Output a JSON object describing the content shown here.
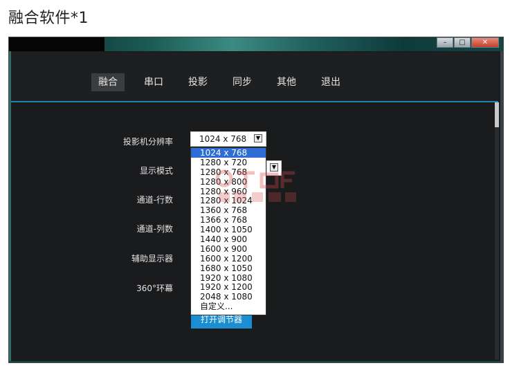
{
  "page_heading": "融合软件*1",
  "window": {
    "controls": {
      "minimize": "–",
      "maximize": "□",
      "close": "✕"
    }
  },
  "menu": {
    "items": [
      {
        "label": "融合",
        "active": true
      },
      {
        "label": "串口",
        "active": false
      },
      {
        "label": "投影",
        "active": false
      },
      {
        "label": "同步",
        "active": false
      },
      {
        "label": "其他",
        "active": false
      },
      {
        "label": "退出",
        "active": false
      }
    ]
  },
  "form": {
    "projector_resolution_label": "投影机分辨率",
    "projector_resolution_value": "1024 x 768",
    "display_mode_label": "显示模式",
    "channel_rows_label": "通道-行数",
    "channel_cols_label": "通道-列数",
    "aux_display_label": "辅助显示器",
    "curtain_360_label": "360°环幕"
  },
  "dropdown": {
    "options": [
      "1024 x 768",
      "1280 x 720",
      "1280 x 768",
      "1280 x 800",
      "1280 x 960",
      "1280 x 1024",
      "1360 x 768",
      "1366 x 768",
      "1400 x 1050",
      "1440 x 900",
      "1600 x 900",
      "1600 x 1200",
      "1680 x 1050",
      "1920 x 1080",
      "1920 x 1200",
      "2048 x 1080",
      "自定义..."
    ],
    "selected_index": 0
  },
  "open_adjuster_button": "打开调节器",
  "colors": {
    "accent_line": "#2b7fb4",
    "selected_option": "#2f6dd6",
    "button_blue": "#1a8ed1"
  }
}
